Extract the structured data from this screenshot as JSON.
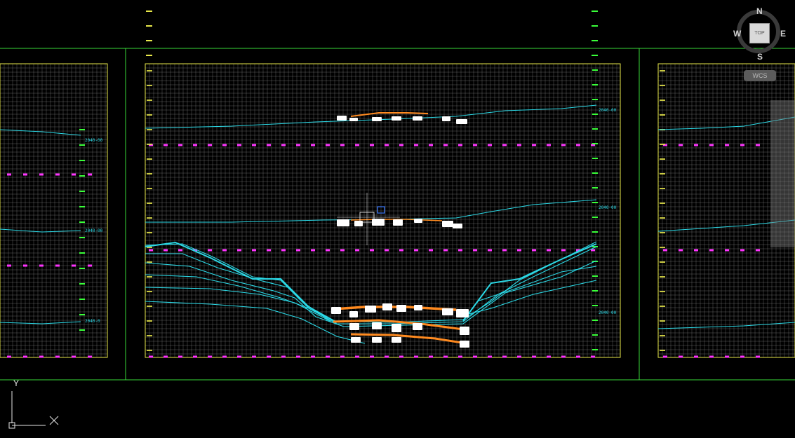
{
  "viewcube": {
    "north": "N",
    "south": "S",
    "east": "E",
    "west": "W",
    "top_face": "TOP",
    "icon": "viewcube-compass-icon"
  },
  "ucs": {
    "menu_label": "WCS",
    "axis_y": "Y",
    "axis_x_icon": "ucs-x-axis-icon"
  },
  "colors": {
    "background": "#000000",
    "viewport_border": "#39d839",
    "grid": "#bdbdbd",
    "frame": "#e8e84a",
    "ground_line": "#2bd9e6",
    "design_line": "#ff8a1f",
    "datum_marker": "#ff33ff",
    "elevation_text": "#39ff39"
  },
  "drawing": {
    "left_labels": [
      "2040-00",
      "2040-00",
      "2040-0"
    ],
    "center_labels": [
      "2040-00",
      "2040-00",
      "2040-00"
    ]
  }
}
